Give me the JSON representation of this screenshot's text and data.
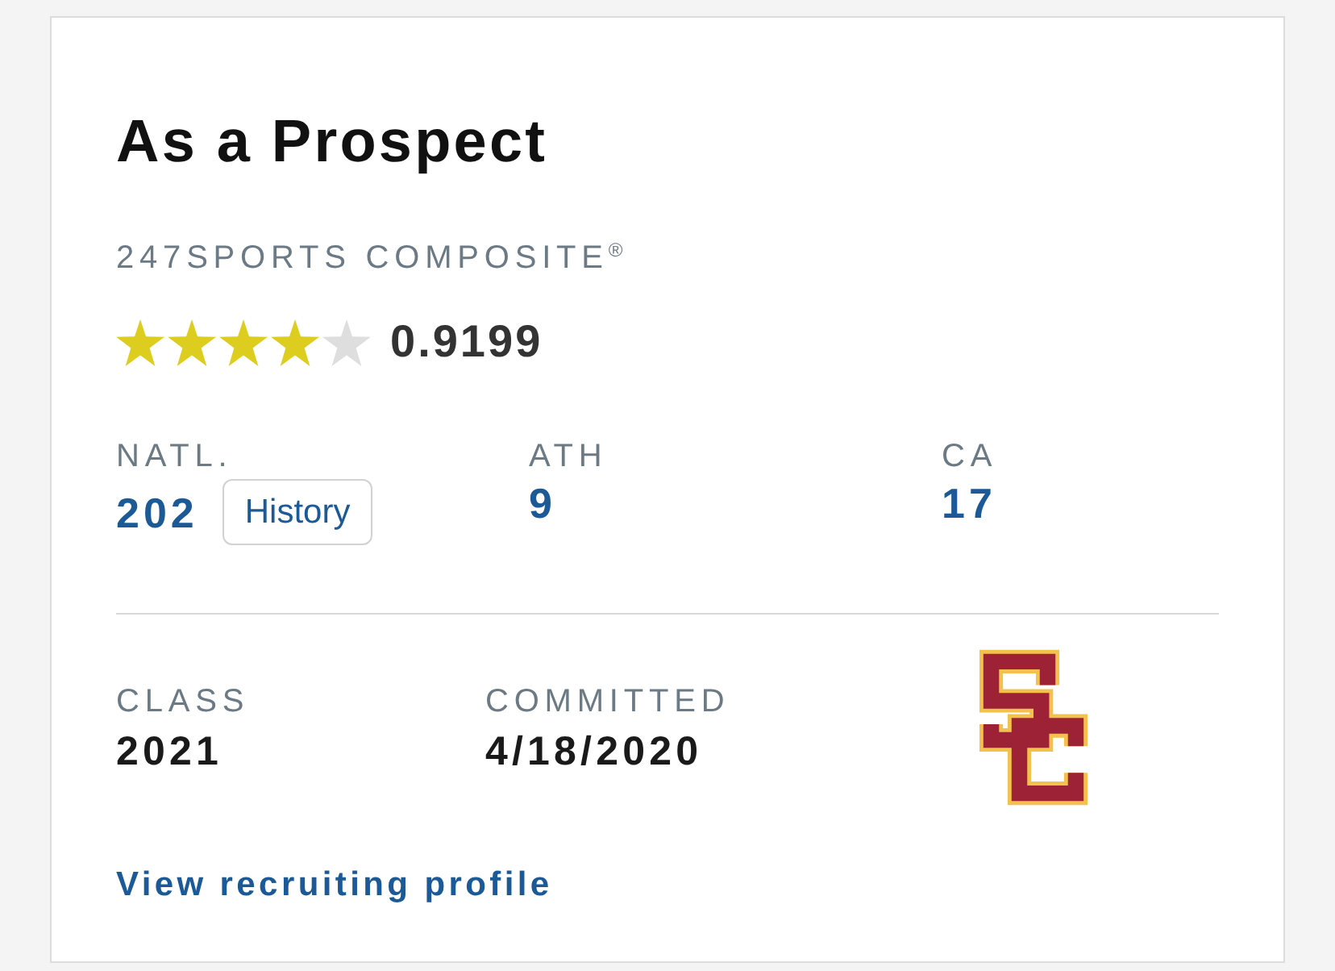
{
  "card": {
    "title": "As a Prospect",
    "rating": {
      "label": "247SPORTS COMPOSITE$^{®}$",
      "stars": 4,
      "score": "0.9199"
    },
    "rankings": [
      {
        "label": "NATL.",
        "value": "202",
        "history_button": "History"
      },
      {
        "label": "ATH",
        "value": "9"
      },
      {
        "label": "CA",
        "value": "17"
      }
    ],
    "details": [
      {
        "label": "CLASS",
        "value": "2021"
      },
      {
        "label": "COMMITTED",
        "value": "4/18/2020"
      }
    ],
    "link": "View recruiting profile"
  }
}
